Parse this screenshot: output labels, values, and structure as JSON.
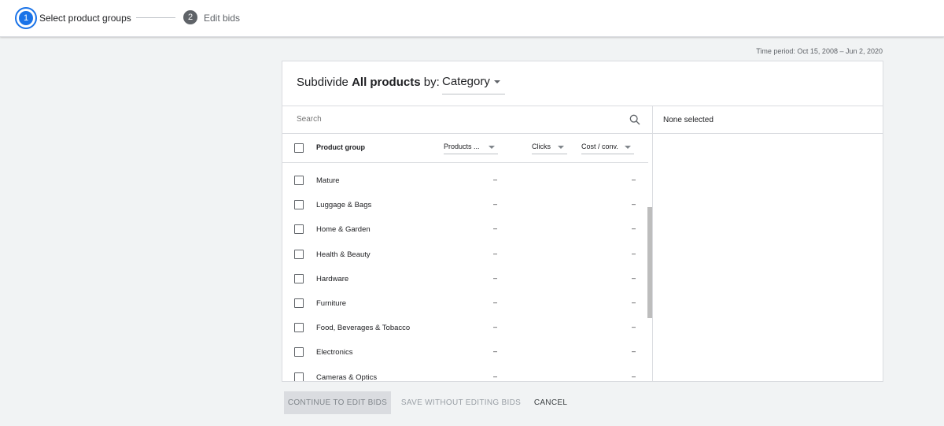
{
  "stepper": {
    "step1": {
      "number": "1",
      "label": "Select product groups"
    },
    "step2": {
      "number": "2",
      "label": "Edit bids"
    }
  },
  "time_period": "Time period: Oct 15, 2008 – Jun 2, 2020",
  "card": {
    "title_prefix": "Subdivide",
    "title_bold": "All products",
    "title_suffix": "by:",
    "category_value": "Category",
    "search": {
      "placeholder": "Search"
    },
    "columns": {
      "product_group": "Product group",
      "products": "Products ...",
      "clicks": "Clicks",
      "cost_conv": "Cost / conv."
    },
    "rows": [
      {
        "label": "Mature",
        "products": "–",
        "cost": "–"
      },
      {
        "label": "Luggage & Bags",
        "products": "–",
        "cost": "–"
      },
      {
        "label": "Home & Garden",
        "products": "–",
        "cost": "–"
      },
      {
        "label": "Health & Beauty",
        "products": "–",
        "cost": "–"
      },
      {
        "label": "Hardware",
        "products": "–",
        "cost": "–"
      },
      {
        "label": "Furniture",
        "products": "–",
        "cost": "–"
      },
      {
        "label": "Food, Beverages & Tobacco",
        "products": "–",
        "cost": "–"
      },
      {
        "label": "Electronics",
        "products": "–",
        "cost": "–"
      },
      {
        "label": "Cameras & Optics",
        "products": "–",
        "cost": "–"
      }
    ],
    "selected_panel": "None selected"
  },
  "footer": {
    "continue_label": "CONTINUE TO EDIT BIDS",
    "save_label": "SAVE WITHOUT EDITING BIDS",
    "cancel_label": "CANCEL"
  },
  "colors": {
    "accent": "#1a73e8",
    "background": "#f1f3f4"
  }
}
